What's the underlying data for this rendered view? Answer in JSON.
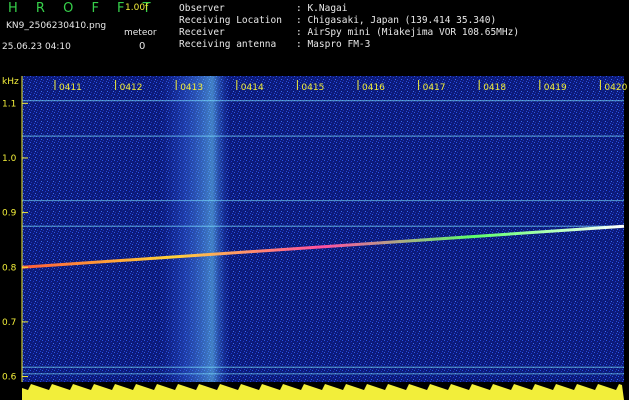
{
  "header": {
    "title": "H R O F F T",
    "version": "1.00f",
    "filename": "KN9_2506230410.png",
    "meteor_label": "meteor",
    "datetime": "25.06.23 04:10",
    "meteor_count": "0"
  },
  "info": [
    {
      "label": "Observer",
      "value": ": K.Nagai"
    },
    {
      "label": "Receiving Location",
      "value": ": Chigasaki, Japan (139.414 35.340)"
    },
    {
      "label": "Receiver",
      "value": ": AirSpy mini (Miakejima VOR 108.65MHz)"
    },
    {
      "label": "Receiving antenna",
      "value": ": Maspro FM-3"
    }
  ],
  "colors": {
    "background": "#000000",
    "title_green": "#36d04a",
    "yellow": "#f2ee3a",
    "noise_blue": "#1f3fd8",
    "noise_cyan": "#5bd6ff"
  },
  "chart_data": {
    "type": "heatmap",
    "y_unit": "kHz",
    "x_ticks": [
      "0411",
      "0412",
      "0413",
      "0414",
      "0415",
      "0416",
      "0417",
      "0418",
      "0419",
      "0420"
    ],
    "y_ticks": [
      "1.1",
      "1.0",
      "0.9",
      "0.8",
      "0.7",
      "0.6"
    ],
    "ylim": [
      0.59,
      1.15
    ],
    "vor_drift_line": {
      "start_khz": 0.8,
      "end_khz": 0.875
    },
    "horizontal_lines_khz": [
      1.105,
      1.04,
      0.922,
      0.875,
      0.617,
      0.605
    ],
    "bright_band_minute": "0413"
  }
}
